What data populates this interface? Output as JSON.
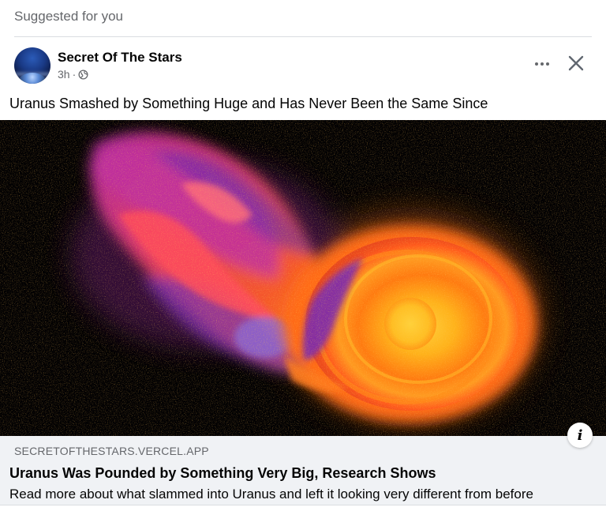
{
  "feed": {
    "section_label": "Suggested for you"
  },
  "post": {
    "page_name": "Secret Of The Stars",
    "time": "3h",
    "separator": "·",
    "privacy_icon": "globe-icon",
    "text": "Uranus Smashed by Something Huge and Has Never Been the Same Since",
    "actions": {
      "more_icon": "more-horizontal-icon",
      "close_icon": "close-icon"
    }
  },
  "link_preview": {
    "image_alt": "Simulated giant impact on Uranus",
    "domain": "SECRETOFTHESTARS.VERCEL.APP",
    "title": "Uranus Was Pounded by Something Very Big, Research Shows",
    "description": "Read more about what slammed into Uranus and left it looking very different from before",
    "info_glyph": "i"
  },
  "colors": {
    "secondary_text": "#65676b",
    "card_bg": "#f0f2f5",
    "divider": "#dadde1"
  }
}
